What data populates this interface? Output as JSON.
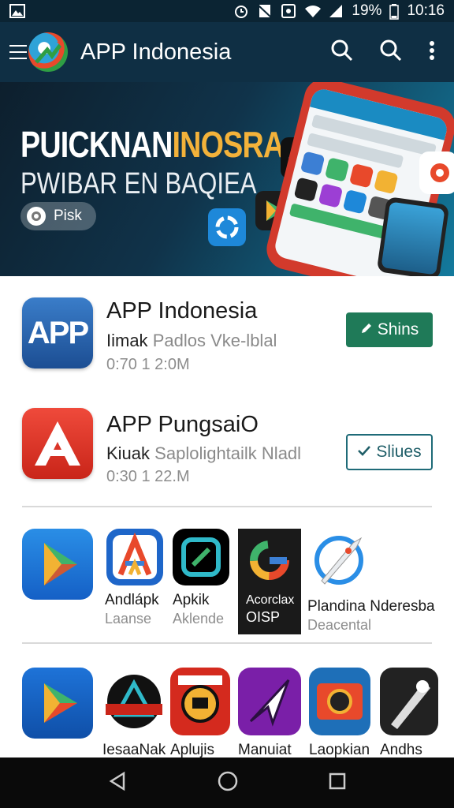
{
  "status_bar": {
    "battery_percent": "19%",
    "time": "10:16",
    "icons": [
      "image-icon",
      "alarm-icon",
      "no-sim-icon",
      "nfc-icon",
      "wifi-icon",
      "signal-icon"
    ]
  },
  "app_bar": {
    "title": "APP Indonesia",
    "icons": [
      "menu-icon",
      "search-icon",
      "search-icon",
      "more-vert-icon"
    ]
  },
  "banner": {
    "line1_white": "PUICKNAN",
    "line1_yellow": "INOSRA",
    "line2": "PWIBAR EN BAQIEA",
    "pill_label": "Pisk",
    "accent_yellow": "#f3b23a"
  },
  "featured": [
    {
      "name": "APP Indonesia",
      "subtitle_dark": "Iimak",
      "subtitle_light": "Padlos Vke-lblal",
      "meta": "0:70 1 2:0M",
      "icon_text": "APP",
      "button_label": "Shins",
      "button_icon": "pencil-icon",
      "button_color": "#1f7a58"
    },
    {
      "name": "APP PungsaiO",
      "subtitle_dark": "Kiuak",
      "subtitle_light": "Saplolightailk Nladl",
      "meta": "0:30 1 22.M",
      "button_label": "Sliues",
      "button_icon": "check-icon"
    }
  ],
  "grid_row_1": [
    {
      "name": "",
      "sub": "",
      "icon": "prism-icon"
    },
    {
      "name": "Andlápk",
      "sub": "Laanse",
      "icon": "a-logo-icon"
    },
    {
      "name": "Apkik",
      "sub": "Aklende",
      "icon": "square-frame-icon"
    },
    {
      "name": "Acorclax",
      "sub": "OISP",
      "icon": "google-g-icon"
    },
    {
      "name": "Plandina Nderesba",
      "sub": "Deacental",
      "icon": "rocket-icon"
    }
  ],
  "grid_row_2": [
    {
      "name": "",
      "icon": "play-triangle-icon"
    },
    {
      "name": "IesaaNak",
      "icon": "emblem-icon"
    },
    {
      "name": "Aplujis",
      "icon": "badge-icon"
    },
    {
      "name": "Manuiat",
      "icon": "arrow-cursor-icon"
    },
    {
      "name": "Laopkian",
      "icon": "camera-badge-icon"
    },
    {
      "name": "Andhs",
      "icon": "pen-art-icon"
    }
  ],
  "nav_bar": {
    "icons": [
      "back-icon",
      "home-icon",
      "recents-icon"
    ]
  }
}
